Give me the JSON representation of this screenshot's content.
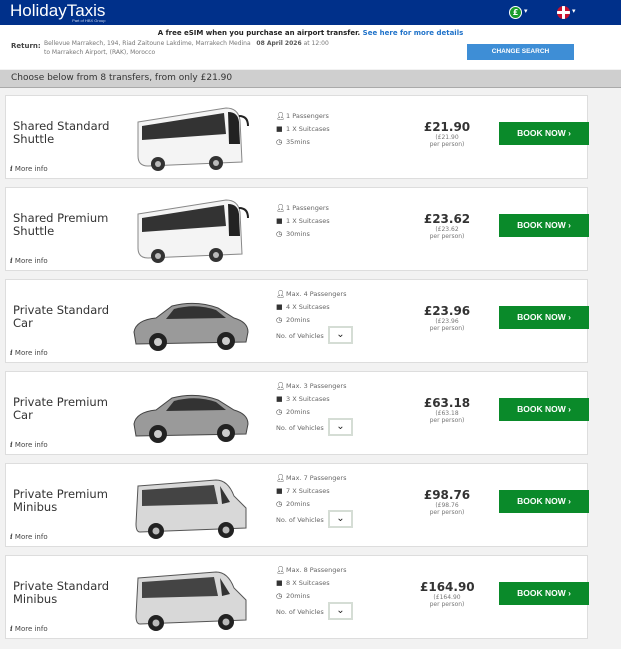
{
  "header": {
    "logo": "HolidayTaxis",
    "logo_sub": "Part of HBX Group",
    "currency_icon": "pound-icon",
    "currency_symbol": "£",
    "language_icon": "uk-flag-icon"
  },
  "banner": {
    "text": "A free eSIM when you purchase an airport transfer.",
    "link": "See here for more details"
  },
  "return": {
    "label": "Return:",
    "from": "Bellevue Marrakech, 194, Riad Zaitoune Lakdime, Marrakech Medina",
    "date": "08 April 2026",
    "at": "at 12:00",
    "to": "to Marrakech Airport, (RAK), Morocco"
  },
  "change_search": "CHANGE SEARCH",
  "summary": "Choose below from 8 transfers, from only £21.90",
  "more_info": "More info",
  "vehicles_label": "No. of Vehicles",
  "book_label": "BOOK NOW ›",
  "transfers": [
    {
      "title": "Shared Standard Shuttle",
      "type": "bus",
      "passengers": "1 Passengers",
      "suitcases": "1 X Suitcases",
      "time": "35mins",
      "price": "£21.90",
      "per": "(£21.90",
      "per2": "per person)",
      "vehicles": false
    },
    {
      "title": "Shared Premium Shuttle",
      "type": "bus",
      "passengers": "1 Passengers",
      "suitcases": "1 X Suitcases",
      "time": "30mins",
      "price": "£23.62",
      "per": "(£23.62",
      "per2": "per person)",
      "vehicles": false
    },
    {
      "title": "Private Standard Car",
      "type": "car",
      "passengers": "Max. 4 Passengers",
      "suitcases": "4 X Suitcases",
      "time": "20mins",
      "price": "£23.96",
      "per": "(£23.96",
      "per2": "per person)",
      "vehicles": true
    },
    {
      "title": "Private Premium Car",
      "type": "car",
      "passengers": "Max. 3 Passengers",
      "suitcases": "3 X Suitcases",
      "time": "20mins",
      "price": "£63.18",
      "per": "(£63.18",
      "per2": "per person)",
      "vehicles": true
    },
    {
      "title": "Private Premium Minibus",
      "type": "van",
      "passengers": "Max. 7 Passengers",
      "suitcases": "7 X Suitcases",
      "time": "20mins",
      "price": "£98.76",
      "per": "(£98.76",
      "per2": "per person)",
      "vehicles": true
    },
    {
      "title": "Private Standard Minibus",
      "type": "van",
      "passengers": "Max. 8 Passengers",
      "suitcases": "8 X Suitcases",
      "time": "20mins",
      "price": "£164.90",
      "per": "(£164.90",
      "per2": "per person)",
      "vehicles": true
    }
  ]
}
